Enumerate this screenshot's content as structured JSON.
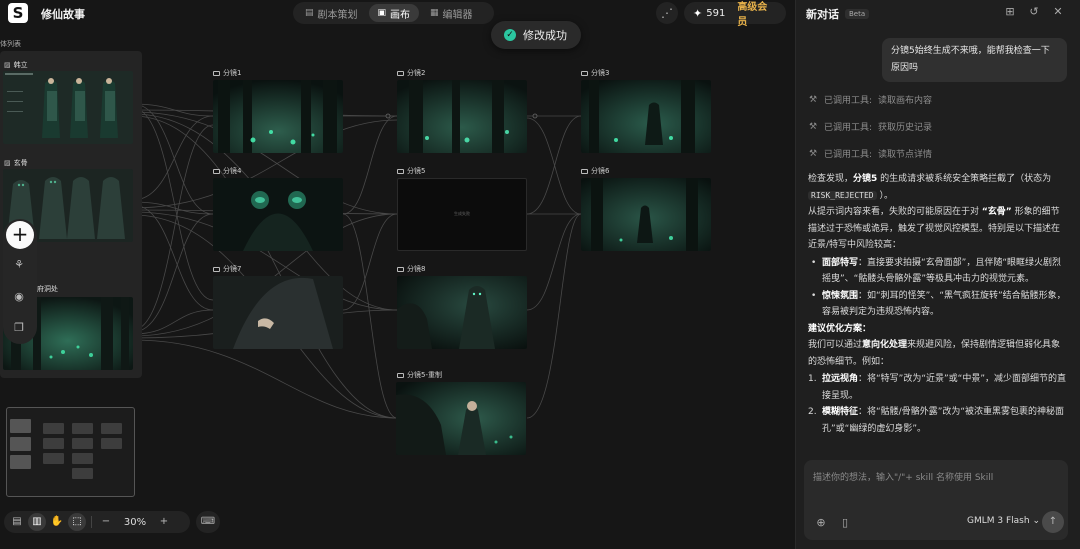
{
  "app": {
    "project_title": "修仙故事"
  },
  "tabs": [
    {
      "label": "剧本策划",
      "icon": "script-icon",
      "active": false
    },
    {
      "label": "画布",
      "icon": "canvas-icon",
      "active": true
    },
    {
      "label": "编辑器",
      "icon": "editor-icon",
      "active": false
    }
  ],
  "header": {
    "credits": "591",
    "vip_label": "高级会员"
  },
  "toast": {
    "text": "修改成功"
  },
  "character_panel": {
    "title": "体列表",
    "characters": [
      {
        "name": "韩立"
      },
      {
        "name": "玄骨"
      },
      {
        "name": "洞府洞处"
      }
    ]
  },
  "shots": [
    {
      "label": "分镜1",
      "has_image": true
    },
    {
      "label": "分镜2",
      "has_image": true
    },
    {
      "label": "分镜3",
      "has_image": true
    },
    {
      "label": "分镜4",
      "has_image": true
    },
    {
      "label": "分镜5",
      "has_image": false,
      "placeholder": "生成失败"
    },
    {
      "label": "分镜6",
      "has_image": true
    },
    {
      "label": "分镜7",
      "has_image": true
    },
    {
      "label": "分镜8",
      "has_image": true
    },
    {
      "label": "分镜5-重制",
      "has_image": true
    }
  ],
  "toolbar": {
    "zoom": "30%"
  },
  "chat": {
    "title": "新对话",
    "beta": "Beta",
    "user_message": "分镜5始终生成不来哦，能帮我检查一下原因吗",
    "tool_calls": [
      {
        "prefix": "已调用工具:",
        "name": "读取画布内容"
      },
      {
        "prefix": "已调用工具:",
        "name": "获取历史记录"
      },
      {
        "prefix": "已调用工具:",
        "name": "读取节点详情"
      }
    ],
    "reply": {
      "p1_a": "检查发现，",
      "p1_b": "分镜5",
      "p1_c": " 的生成请求被系统安全策略拦截了（状态为 ",
      "p1_code": "RISK_REJECTED",
      "p1_d": " ）。",
      "p2_a": "从提示词内容来看，失败的可能原因在于对 ",
      "p2_b": "“玄骨”",
      "p2_c": " 形象的细节描述过于恐怖或诡异，触发了视觉风控模型。特别是以下描述在近景/特写中风险较高：",
      "bullets": [
        {
          "head": "面部特写",
          "text": "：直接要求拍摄“玄骨面部”，且伴随“眼眶绿火剧烈摇曳”、“骷髅头骨骼外露”等极具冲击力的视觉元素。"
        },
        {
          "head": "惊悚氛围",
          "text": "：如“刺耳的怪笑”、“黑气疯狂旋转”结合骷髅形象，容易被判定为违规恐怖内容。"
        }
      ],
      "suggest_title": "建议优化方案：",
      "suggest_a": "我们可以通过",
      "suggest_b": "意向化处理",
      "suggest_c": "来规避风险，保持剧情逻辑但弱化具象的恐怖细节。例如：",
      "steps": [
        {
          "n": "1.",
          "head": "拉远视角",
          "text": "：将“特写”改为“近景”或“中景”，减少面部细节的直接呈现。"
        },
        {
          "n": "2.",
          "head": "模糊特征",
          "text": "：将“骷髅/骨骼外露”改为“被浓重黑雾包裹的神秘面孔”或“幽绿的虚幻身影”。"
        }
      ]
    },
    "input_placeholder": "描述你的想法，输入\"/\"+ skill 名称使用 Skill",
    "model": "GMLM 3 Flash"
  }
}
